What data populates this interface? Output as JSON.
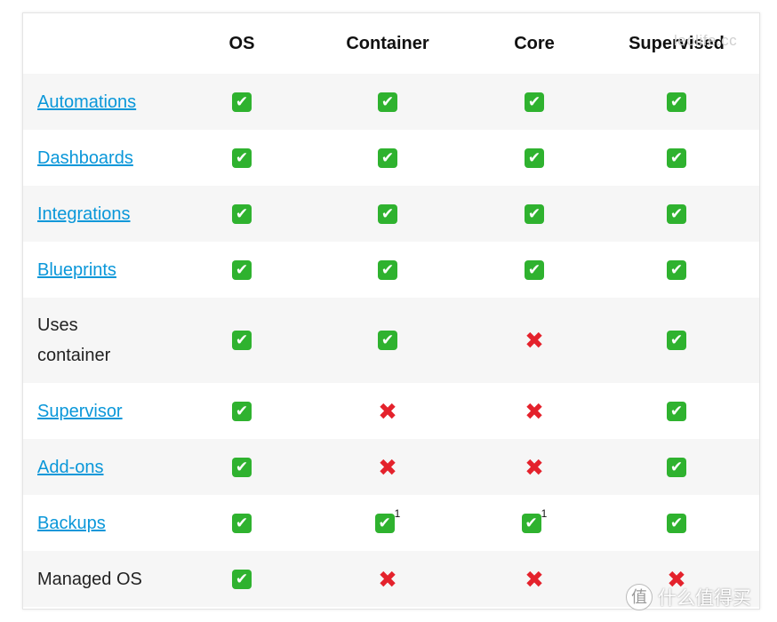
{
  "table": {
    "headers": [
      "",
      "OS",
      "Container",
      "Core",
      "Supervised"
    ],
    "rows": [
      {
        "feature": "Automations",
        "link": true,
        "cells": [
          "check",
          "check",
          "check",
          "check"
        ],
        "footnotes": [
          "",
          "",
          "",
          ""
        ]
      },
      {
        "feature": "Dashboards",
        "link": true,
        "cells": [
          "check",
          "check",
          "check",
          "check"
        ],
        "footnotes": [
          "",
          "",
          "",
          ""
        ]
      },
      {
        "feature": "Integrations",
        "link": true,
        "cells": [
          "check",
          "check",
          "check",
          "check"
        ],
        "footnotes": [
          "",
          "",
          "",
          ""
        ]
      },
      {
        "feature": "Blueprints",
        "link": true,
        "cells": [
          "check",
          "check",
          "check",
          "check"
        ],
        "footnotes": [
          "",
          "",
          "",
          ""
        ]
      },
      {
        "feature": "Uses container",
        "link": false,
        "feature_lines": [
          "Uses",
          "container"
        ],
        "cells": [
          "check",
          "check",
          "cross",
          "check"
        ],
        "footnotes": [
          "",
          "",
          "",
          ""
        ]
      },
      {
        "feature": "Supervisor",
        "link": true,
        "cells": [
          "check",
          "cross",
          "cross",
          "check"
        ],
        "footnotes": [
          "",
          "",
          "",
          ""
        ]
      },
      {
        "feature": "Add-ons",
        "link": true,
        "cells": [
          "check",
          "cross",
          "cross",
          "check"
        ],
        "footnotes": [
          "",
          "",
          "",
          ""
        ]
      },
      {
        "feature": "Backups",
        "link": true,
        "cells": [
          "check",
          "check",
          "check",
          "check"
        ],
        "footnotes": [
          "",
          "1",
          "1",
          ""
        ]
      },
      {
        "feature": "Managed OS",
        "link": false,
        "cells": [
          "check",
          "cross",
          "cross",
          "cross"
        ],
        "footnotes": [
          "",
          "",
          "",
          ""
        ]
      }
    ]
  },
  "icons": {
    "check": "check-mark-icon",
    "cross": "cross-mark-icon"
  },
  "colors": {
    "link": "#0a97d9",
    "check_bg": "#2fb22f",
    "cross": "#e4222c",
    "row_stripe": "#f6f6f6"
  },
  "watermarks": {
    "top": "leolife.cc",
    "bottom": "什么值得买",
    "bottom_logo": "值"
  }
}
